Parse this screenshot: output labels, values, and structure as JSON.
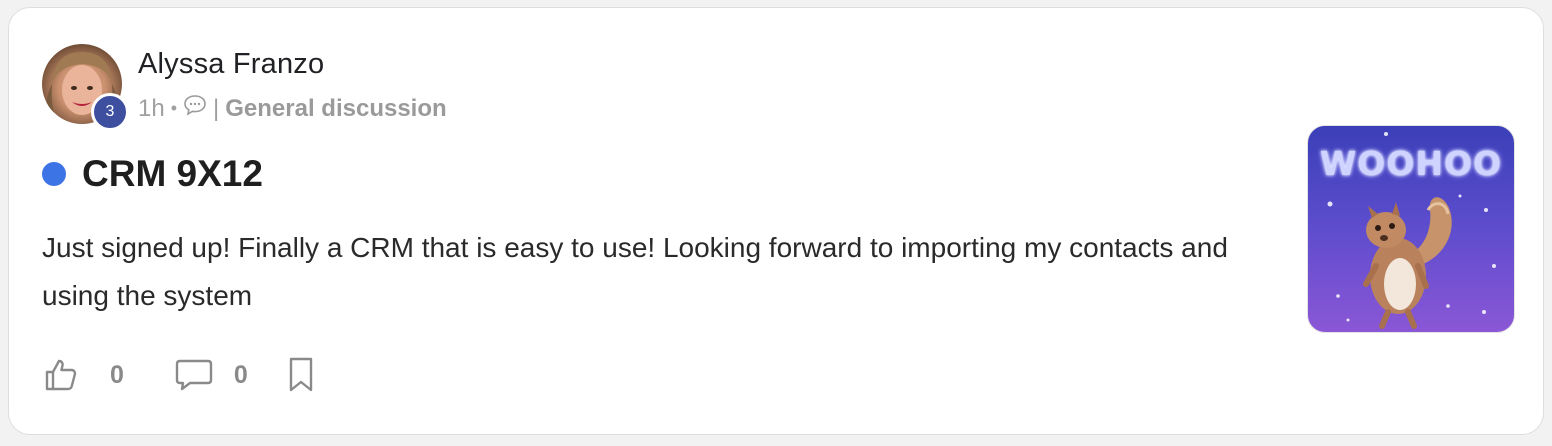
{
  "post": {
    "author": "Alyssa Franzo",
    "level": "3",
    "time": "1h",
    "dot": "•",
    "separator": "|",
    "category": "General discussion",
    "title": "CRM 9X12",
    "body": "Just signed up! Finally a CRM that is easy to use! Looking forward to importing my contacts and using the system",
    "likes": "0",
    "comments": "0",
    "thumbnail_text": "WOOHOO"
  },
  "icons": {
    "category": "speech-bubble-icon",
    "like": "thumbs-up-icon",
    "comment": "comment-icon",
    "bookmark": "bookmark-icon"
  },
  "colors": {
    "unread_dot": "#3c74e6",
    "level_badge": "#3e4fa0",
    "thumbnail_bg_top": "#3b3fb8",
    "thumbnail_bg_bottom": "#8a57d6"
  }
}
